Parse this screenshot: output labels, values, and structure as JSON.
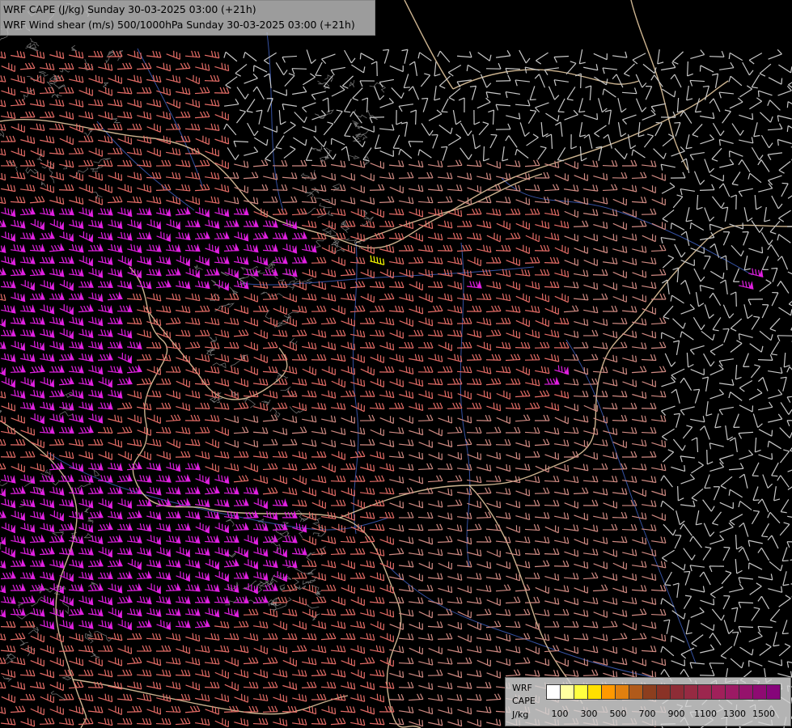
{
  "title": {
    "line1": "WRF CAPE (J/kg) Sunday 30-03-2025 03:00 (+21h)",
    "line2": "WRF Wind shear (m/s) 500/1000hPa Sunday 30-03-2025 03:00 (+21h)"
  },
  "legend": {
    "label_lines": [
      "WRF",
      "CAPE",
      "J/kg"
    ],
    "swatch_colors": [
      "#ffffff",
      "#ffffa0",
      "#ffff40",
      "#ffe000",
      "#ff9900",
      "#e08010",
      "#b05a1a",
      "#8c3e1e",
      "#8a3226",
      "#8e2c36",
      "#962a42",
      "#9c264e",
      "#a0205a",
      "#9c1a64",
      "#96126c",
      "#8e0a72",
      "#86047a"
    ],
    "tick_labels": [
      "100",
      "300",
      "500",
      "700",
      "900",
      "1100",
      "1300",
      "1500"
    ]
  },
  "colors": {
    "background": "#000000",
    "borders": "#f0d2a8",
    "rivers": "#3b5ab4",
    "terrain_contours": "#c8c8c8",
    "barbs_calm": "#c8c8c8",
    "barbs_moderate": "#d08a82",
    "barbs_strong": "#e46c66",
    "barbs_very_strong": "#e020e0",
    "barbs_extreme": "#ffff00"
  }
}
